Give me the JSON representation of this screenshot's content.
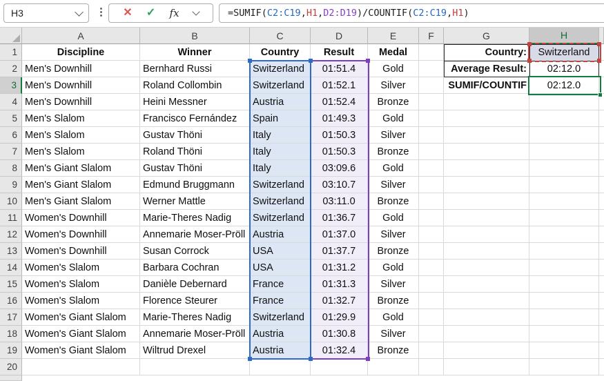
{
  "formula_bar": {
    "name_box": "H3",
    "formula": "=SUMIF(C2:C19,H1,D2:D19)/COUNTIF(C2:C19,H1)",
    "parts": [
      {
        "t": "=SUMIF(",
        "c": "#1e1e1e"
      },
      {
        "t": "C2:C19",
        "c": "#2667C9"
      },
      {
        "t": ",",
        "c": "#1e1e1e"
      },
      {
        "t": "H1",
        "c": "#C2403C"
      },
      {
        "t": ",",
        "c": "#1e1e1e"
      },
      {
        "t": "D2:D19",
        "c": "#8741C8"
      },
      {
        "t": ")/COUNTIF(",
        "c": "#1e1e1e"
      },
      {
        "t": "C2:C19",
        "c": "#2667C9"
      },
      {
        "t": ",",
        "c": "#1e1e1e"
      },
      {
        "t": "H1",
        "c": "#C2403C"
      },
      {
        "t": ")",
        "c": "#1e1e1e"
      }
    ],
    "icons": {
      "cancel": "✕",
      "confirm": "✓",
      "function": "fx",
      "more": "⋮"
    }
  },
  "sheet": {
    "column_letters": [
      "A",
      "B",
      "C",
      "D",
      "E",
      "F",
      "G",
      "H"
    ],
    "row_numbers": [
      "1",
      "2",
      "3",
      "4",
      "5",
      "6",
      "7",
      "8",
      "9",
      "10",
      "11",
      "12",
      "13",
      "14",
      "15",
      "16",
      "17",
      "18",
      "19",
      "20"
    ],
    "header_row": {
      "discipline": "Discipline",
      "winner": "Winner",
      "country": "Country",
      "result": "Result",
      "medal": "Medal"
    },
    "rows": [
      {
        "discipline": "Men's Downhill",
        "winner": "Bernhard Russi",
        "country": "Switzerland",
        "result": "01:51.4",
        "medal": "Gold"
      },
      {
        "discipline": "Men's Downhill",
        "winner": "Roland Collombin",
        "country": "Switzerland",
        "result": "01:52.1",
        "medal": "Silver"
      },
      {
        "discipline": "Men's Downhill",
        "winner": "Heini Messner",
        "country": "Austria",
        "result": "01:52.4",
        "medal": "Bronze"
      },
      {
        "discipline": "Men's Slalom",
        "winner": "Francisco Fernández",
        "country": "Spain",
        "result": "01:49.3",
        "medal": "Gold"
      },
      {
        "discipline": "Men's Slalom",
        "winner": "Gustav Thöni",
        "country": "Italy",
        "result": "01:50.3",
        "medal": "Silver"
      },
      {
        "discipline": "Men's Slalom",
        "winner": "Roland Thöni",
        "country": "Italy",
        "result": "01:50.3",
        "medal": "Bronze"
      },
      {
        "discipline": "Men's Giant Slalom",
        "winner": "Gustav Thöni",
        "country": "Italy",
        "result": "03:09.6",
        "medal": "Gold"
      },
      {
        "discipline": "Men's Giant Slalom",
        "winner": "Edmund Bruggmann",
        "country": "Switzerland",
        "result": "03:10.7",
        "medal": "Silver"
      },
      {
        "discipline": "Men's Giant Slalom",
        "winner": "Werner Mattle",
        "country": "Switzerland",
        "result": "03:11.0",
        "medal": "Bronze"
      },
      {
        "discipline": "Women's Downhill",
        "winner": "Marie-Theres Nadig",
        "country": "Switzerland",
        "result": "01:36.7",
        "medal": "Gold"
      },
      {
        "discipline": "Women's Downhill",
        "winner": "Annemarie Moser-Pröll",
        "country": "Austria",
        "result": "01:37.0",
        "medal": "Silver"
      },
      {
        "discipline": "Women's Downhill",
        "winner": "Susan Corrock",
        "country": "USA",
        "result": "01:37.7",
        "medal": "Bronze"
      },
      {
        "discipline": "Women's Slalom",
        "winner": "Barbara Cochran",
        "country": "USA",
        "result": "01:31.2",
        "medal": "Gold"
      },
      {
        "discipline": "Women's Slalom",
        "winner": "Danièle Debernard",
        "country": "France",
        "result": "01:31.3",
        "medal": "Silver"
      },
      {
        "discipline": "Women's Slalom",
        "winner": "Florence Steurer",
        "country": "France",
        "result": "01:32.7",
        "medal": "Bronze"
      },
      {
        "discipline": "Women's Giant Slalom",
        "winner": "Marie-Theres Nadig",
        "country": "Switzerland",
        "result": "01:29.9",
        "medal": "Gold"
      },
      {
        "discipline": "Women's Giant Slalom",
        "winner": "Annemarie Moser-Pröll",
        "country": "Austria",
        "result": "01:30.8",
        "medal": "Silver"
      },
      {
        "discipline": "Women's Giant Slalom",
        "winner": "Wiltrud Drexel",
        "country": "Austria",
        "result": "01:32.4",
        "medal": "Bronze"
      }
    ],
    "summary": {
      "country_label": "Country:",
      "country_value": "Switzerland",
      "average_label": "Average Result:",
      "average_value": "02:12.0",
      "sumif_label": "SUMIF/COUNTIF",
      "sumif_value": "02:12.0"
    },
    "selection": {
      "active_cell": "H3",
      "selected_column": "H",
      "selected_row": "3",
      "highlighted_ranges": [
        "C2:C19",
        "H1",
        "D2:D19"
      ]
    }
  },
  "colors": {
    "selection_green": "#107C41",
    "reference_blue": "#2E6BC6",
    "reference_blue_fill": "#DDE6F4",
    "reference_red": "#C9403C",
    "reference_red_fill": "#D9DAE8",
    "reference_purple": "#7B3FBF",
    "reference_purple_fill": "#F1EDF9",
    "border_black": "#262626"
  }
}
